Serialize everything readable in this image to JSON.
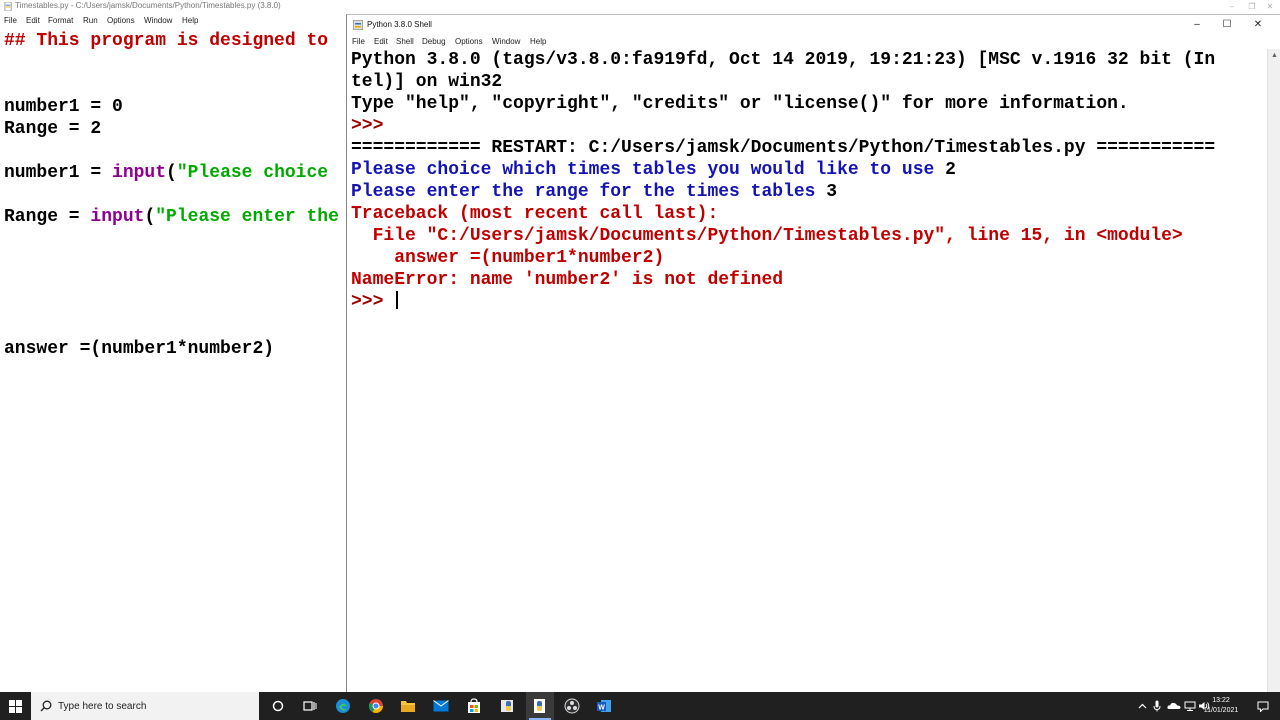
{
  "editor": {
    "title": "Timestables.py - C:/Users/jamsk/Documents/Python/Timestables.py (3.8.0)",
    "menu": [
      "File",
      "Edit",
      "Format",
      "Run",
      "Options",
      "Window",
      "Help"
    ],
    "controls": {
      "minimize": "–",
      "maximize": "❐",
      "close": "✕"
    },
    "code": {
      "line1": "## This program is designed to",
      "line2": "number1 = 0",
      "line3": "Range = 2",
      "line4_var": "number1 = ",
      "line4_fn": "input",
      "line4_paren": "(",
      "line4_str": "\"Please choice",
      "line5_var": "Range = ",
      "line5_fn": "input",
      "line5_paren": "(",
      "line5_str": "\"Please enter the",
      "line6": "answer =(number1*number2)"
    }
  },
  "shell": {
    "title": "Python 3.8.0 Shell",
    "menu": [
      "File",
      "Edit",
      "Shell",
      "Debug",
      "Options",
      "Window",
      "Help"
    ],
    "controls": {
      "minimize": "–",
      "maximize": "☐",
      "close": "✕"
    },
    "lines": {
      "banner1": "Python 3.8.0 (tags/v3.8.0:fa919fd, Oct 14 2019, 19:21:23) [MSC v.1916 32 bit (In",
      "banner2": "tel)] on win32",
      "banner3": "Type \"help\", \"copyright\", \"credits\" or \"license()\" for more information.",
      "prompt": ">>>",
      "restart": "============ RESTART: C:/Users/jamsk/Documents/Python/Timestables.py ===========",
      "q1": "Please choice which times tables you would like to use ",
      "a1": "2",
      "q2": "Please enter the range for the times tables ",
      "a2": "3",
      "tb1": "Traceback (most recent call last):",
      "tb2": "  File \"C:/Users/jamsk/Documents/Python/Timestables.py\", line 15, in <module>",
      "tb3": "    answer =(number1*number2)",
      "tb4": "NameError: name 'number2' is not defined",
      "prompt2": ">>> "
    }
  },
  "taskbar": {
    "search_placeholder": "Type here to search",
    "icons": [
      "windows-start-icon",
      "search-icon",
      "cortana-icon",
      "task-view-icon",
      "edge-icon",
      "chrome-icon",
      "file-explorer-icon",
      "mail-icon",
      "store-icon",
      "python-idle-icon",
      "python-idle-active-icon",
      "obs-icon",
      "word-icon"
    ],
    "time": "13:22",
    "date": "11/01/2021"
  },
  "colors": {
    "comment": "#c00000",
    "builtin": "#900090",
    "string": "#00aa00",
    "stdout": "#1414b4",
    "stderr": "#c00000",
    "prompt": "#9b0000",
    "taskbar": "#202020"
  }
}
